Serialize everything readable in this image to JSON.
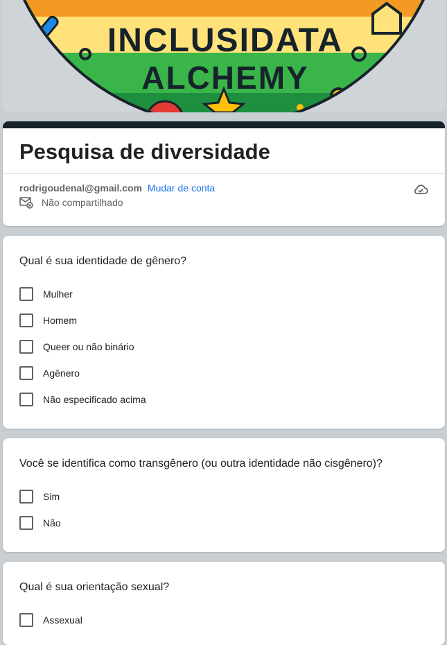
{
  "banner": {
    "logo_line1": "INCLUSIDATA",
    "logo_line2": "ALCHEMY",
    "colors": {
      "orange": "#f29a23",
      "yellow": "#ffe27a",
      "green": "#3ab54a",
      "darkgreen": "#1d8f3e",
      "navy": "#17232b"
    }
  },
  "form": {
    "title": "Pesquisa de diversidade",
    "account_email": "rodrigoudenal@gmail.com",
    "switch_account": "Mudar de conta",
    "not_shared": "Não compartilhado"
  },
  "questions": [
    {
      "title": "Qual é sua identidade de gênero?",
      "options": [
        "Mulher",
        "Homem",
        "Queer ou não binário",
        "Agênero",
        "Não especificado acima"
      ]
    },
    {
      "title": "Você se identifica como transgênero (ou outra identidade não cisgênero)?",
      "options": [
        "Sim",
        "Não"
      ]
    },
    {
      "title": "Qual é sua orientação sexual?",
      "options": [
        "Assexual"
      ]
    }
  ],
  "theme": {
    "accent": "#17232b",
    "link": "#1a73e8",
    "background": "#c9ced3"
  }
}
